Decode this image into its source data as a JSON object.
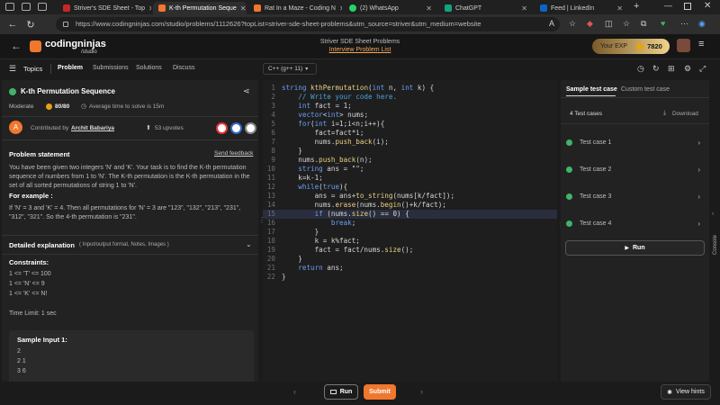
{
  "browser": {
    "tabs": [
      {
        "label": "Striver's SDE Sheet - Top"
      },
      {
        "label": "K-th Permutation Seque"
      },
      {
        "label": "Rat In a Maze - Coding N"
      },
      {
        "label": "(2) WhatsApp"
      },
      {
        "label": "ChatGPT"
      },
      {
        "label": "Feed | LinkedIn"
      }
    ],
    "url": "https://www.codingninjas.com/studio/problems/1112626?topList=striver-sde-sheet-problems&utm_source=striver&utm_medium=website"
  },
  "site": {
    "logo_text": "codingninjas",
    "logo_sub": "/studio",
    "sheet_title": "Striver SDE Sheet Problems",
    "sheet_link": "Interview Problem List",
    "exp_label": "Your EXP",
    "exp_value": "7820"
  },
  "toolbar": {
    "topics": "Topics",
    "tabs": [
      "Problem",
      "Submissions",
      "Solutions",
      "Discuss"
    ],
    "language": "C++ (g++ 11)"
  },
  "problem": {
    "title": "K-th Permutation Sequence",
    "difficulty": "Moderate",
    "score": "80/80",
    "avg_time": "Average time to solve is 15m",
    "contributor_prefix": "Contributed by",
    "contributor": "Archit Babariya",
    "avatar_letter": "A",
    "upvotes": "53 upvotes",
    "statement_heading": "Problem statement",
    "send_feedback": "Send feedback",
    "statement": "You have been given two integers 'N' and 'K'. Your task is to find the K-th permutation sequence of numbers from 1 to 'N'. The K-th permutation is the K-th permutation in the set of all sorted permutations of string 1 to 'N'.",
    "example_heading": "For example :",
    "example": "If 'N' = 3 and 'K' = 4. Then all permutations for 'N' = 3 are \"123\", \"132\", \"213\", \"231\", \"312\", \"321\". So the 4-th permutation is \"231\".",
    "detailed_heading": "Detailed explanation",
    "detailed_sub": "( Input/output format, Notes, Images )",
    "constraints_heading": "Constraints:",
    "constraints": [
      "1 <= 'T' <= 100",
      "1 <= 'N' <= 9",
      "1 <= 'K' <= N!"
    ],
    "time_limit": "Time Limit: 1 sec",
    "sample_heading": "Sample Input 1:",
    "sample_lines": [
      "2",
      "2 1",
      "3 6"
    ]
  },
  "code_lines": [
    "string kthPermutation(int n, int k) {",
    "    // Write your code here.",
    "    int fact = 1;",
    "    vector<int> nums;",
    "    for(int i=1;i<n;i++){",
    "        fact=fact*i;",
    "        nums.push_back(i);",
    "    }",
    "    nums.push_back(n);",
    "    string ans = \"\";",
    "    k=k-1;",
    "    while(true){",
    "        ans = ans+to_string(nums[k/fact]);",
    "        nums.erase(nums.begin()+k/fact);",
    "        if (nums.size() == 0) {",
    "            break;",
    "        }",
    "        k = k%fact;",
    "        fact = fact/nums.size();",
    "    }",
    "    return ans;",
    "}"
  ],
  "right": {
    "tab_sample": "Sample test case",
    "tab_custom": "Custom test case",
    "count": "4 Test cases",
    "download": "Download",
    "cases": [
      "Test case 1",
      "Test case 2",
      "Test case 3",
      "Test case 4"
    ],
    "run": "Run",
    "console": "Console"
  },
  "bottom": {
    "run": "Run",
    "submit": "Submit",
    "hints": "View hints"
  },
  "colors": {
    "accent": "#f0772e",
    "success": "#3fb46a",
    "highlight_line": "#2a2d3d"
  }
}
